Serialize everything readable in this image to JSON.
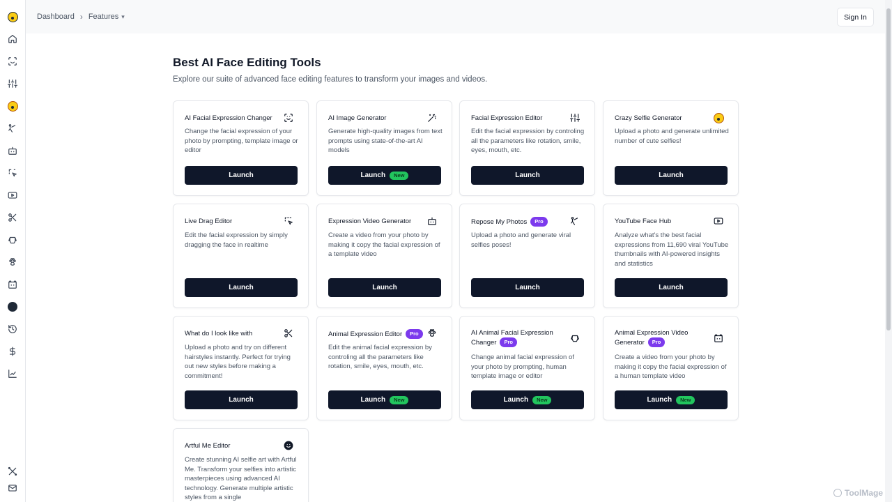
{
  "header": {
    "breadcrumb_home": "Dashboard",
    "breadcrumb_current": "Features",
    "sign_in": "Sign In"
  },
  "page": {
    "title": "Best AI Face Editing Tools",
    "subtitle": "Explore our suite of advanced face editing features to transform your images and videos."
  },
  "badges": {
    "new": "New",
    "pro": "Pro"
  },
  "launch_label": "Launch",
  "cards": [
    {
      "title": "AI Facial Expression Changer",
      "desc": "Change the facial expression of your photo by prompting, template image or editor",
      "icon": "face-scan-icon"
    },
    {
      "title": "AI Image Generator",
      "desc": "Generate high-quality images from text prompts using state-of-the-art AI models",
      "icon": "magic-wand-icon"
    },
    {
      "title": "Facial Expression Editor",
      "desc": "Edit the facial expression by controling all the parameters like rotation, smile, eyes, mouth, etc.",
      "icon": "sliders-icon"
    },
    {
      "title": "Crazy Selfie Generator",
      "desc": "Upload a photo and generate unlimited number of cute selfies!",
      "icon": "wink-emoji-icon"
    },
    {
      "title": "Live Drag Editor",
      "desc": "Edit the facial expression by simply dragging the face in realtime",
      "icon": "drag-cursor-icon"
    },
    {
      "title": "Expression Video Generator",
      "desc": "Create a video from your photo by making it copy the facial expression of a template video",
      "icon": "bot-icon"
    },
    {
      "title": "Repose My Photos",
      "desc": "Upload a photo and generate viral selfies poses!",
      "icon": "pose-icon"
    },
    {
      "title": "YouTube Face Hub",
      "desc": "Analyze what's the best facial expressions from 11,690 viral YouTube thumbnails with AI-powered insights and statistics",
      "icon": "youtube-icon"
    },
    {
      "title": "What do I look like with",
      "desc": "Upload a photo and try on different hairstyles instantly. Perfect for trying out new styles before making a commitment!",
      "icon": "scissors-icon"
    },
    {
      "title": "Animal Expression Editor",
      "desc": "Edit the animal facial expression by controling all the parameters like rotation, smile, eyes, mouth, etc.",
      "icon": "paw-icon"
    },
    {
      "title": "AI Animal Facial Expression Changer",
      "desc": "Change animal facial expression of your photo by prompting, human template image or editor",
      "icon": "dog-icon"
    },
    {
      "title": "Animal Expression Video Generator",
      "desc": "Create a video from your photo by making it copy the facial expression of a human template video",
      "icon": "cat-icon"
    },
    {
      "title": "Artful Me Editor",
      "desc": "Create stunning AI selfie art with Artful Me. Transform your selfies into artistic masterpieces using advanced AI technology. Generate multiple artistic styles from a single",
      "icon": "smile-icon"
    }
  ],
  "watermark": "ToolMage"
}
